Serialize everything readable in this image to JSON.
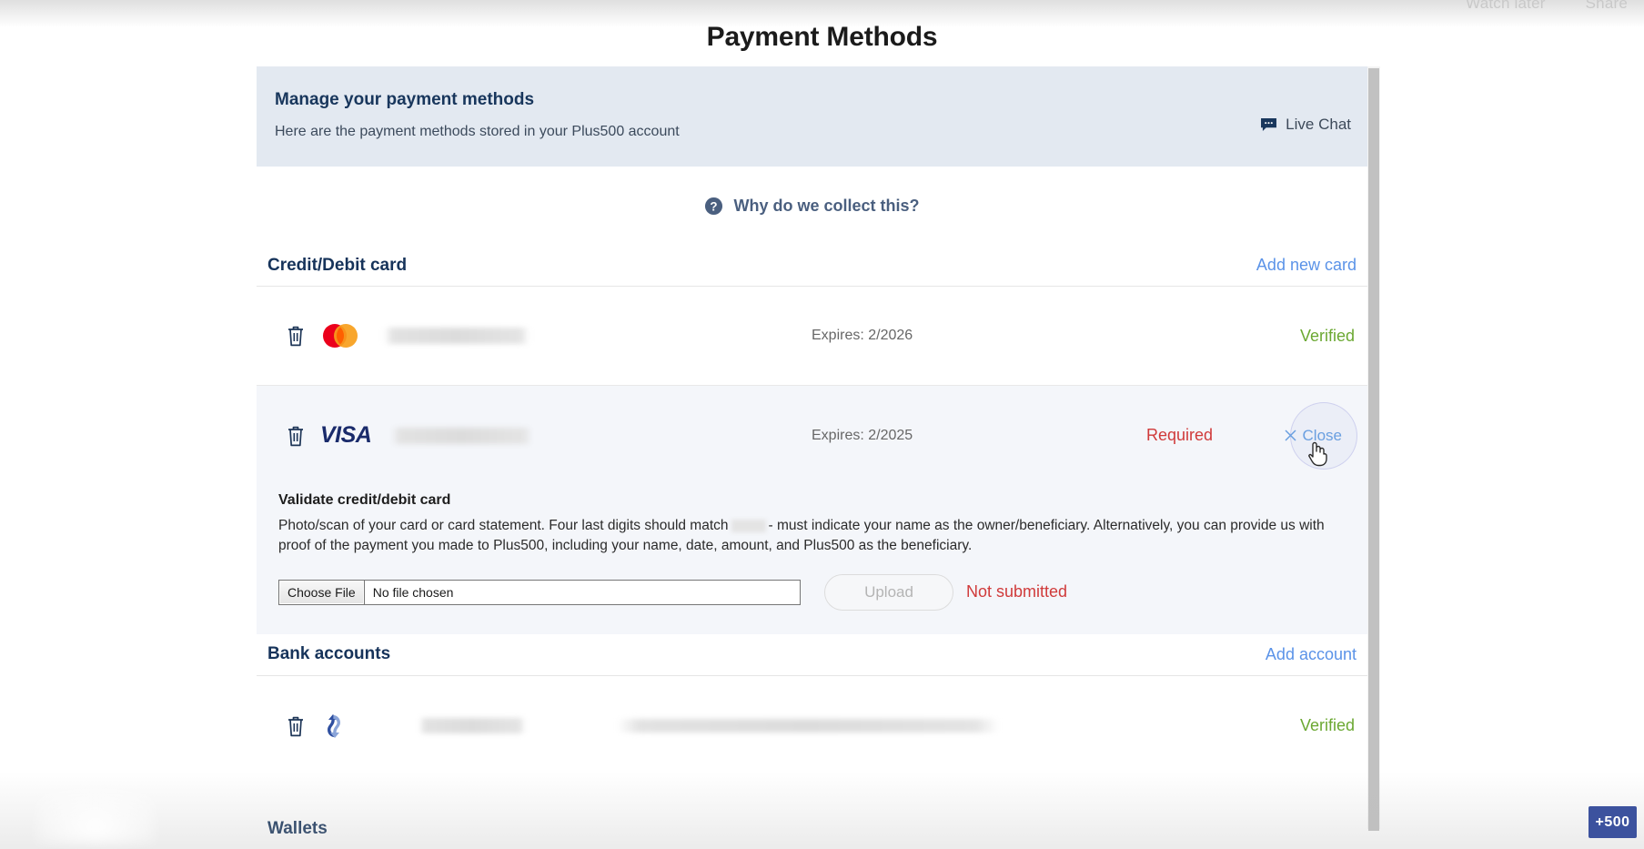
{
  "overlay": {
    "watch_later": "Watch later",
    "share": "Share"
  },
  "page": {
    "title": "Payment Methods"
  },
  "banner": {
    "title": "Manage your payment methods",
    "subtitle": "Here are the payment methods stored in your Plus500 account",
    "live_chat_label": "Live Chat",
    "live_chat_icon": "chat-bubble-icon",
    "bg_color": "#e3e9f1"
  },
  "why": {
    "label": "Why do we collect this?",
    "icon": "question-mark-circle-icon",
    "color": "#4a5f7f"
  },
  "sections": {
    "cards": {
      "title": "Credit/Debit card",
      "action": "Add new card"
    },
    "bank": {
      "title": "Bank accounts",
      "action": "Add account"
    },
    "wallets": {
      "title": "Wallets",
      "action": ""
    }
  },
  "cards": [
    {
      "brand": "mastercard",
      "brand_label": "",
      "number_masked": "",
      "expires": "Expires: 2/2026",
      "status": "Verified",
      "status_color": "#6ba832",
      "delete_icon": "trash-icon"
    },
    {
      "brand": "visa",
      "brand_label": "VISA",
      "number_masked": "",
      "expires": "Expires: 2/2025",
      "status": "Required",
      "status_color": "#d03a3a",
      "close_label": "Close",
      "close_icon": "close-x-icon",
      "delete_icon": "trash-icon"
    }
  ],
  "validate": {
    "title": "Validate credit/debit card",
    "body_part1": "Photo/scan of your card or card statement. Four last digits should match",
    "body_part2": "- must indicate your name as the owner/beneficiary. Alternatively, you can provide us with proof of the payment you made to Plus500, including your name, date, amount, and Plus500 as the beneficiary.",
    "choose_file_label": "Choose File",
    "file_name": "No file chosen",
    "upload_label": "Upload",
    "submit_status": "Not submitted",
    "submit_status_color": "#d03a3a"
  },
  "bank_accounts": [
    {
      "icon": "bank-transfer-icon",
      "name_masked": "",
      "number_masked": "",
      "status": "Verified",
      "status_color": "#6ba832",
      "delete_icon": "trash-icon"
    }
  ],
  "brand_badge": {
    "label": "+500",
    "color": "#3c529e"
  }
}
